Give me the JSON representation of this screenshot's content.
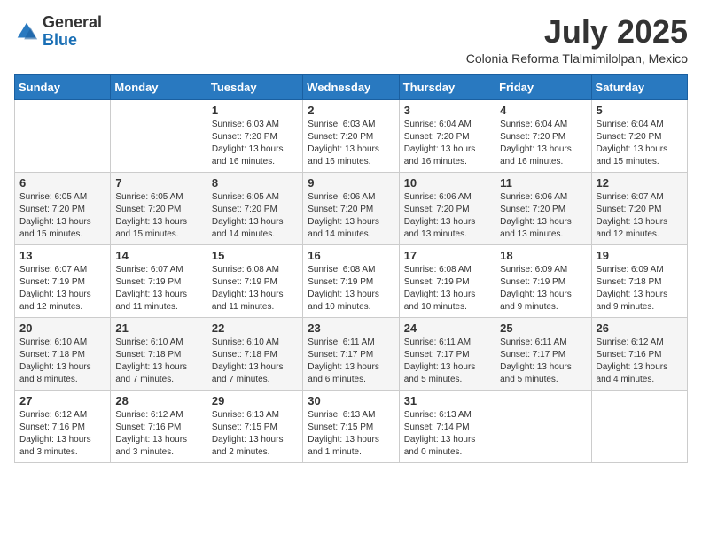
{
  "logo": {
    "general": "General",
    "blue": "Blue"
  },
  "title": {
    "month_year": "July 2025",
    "location": "Colonia Reforma Tlalmimilolpan, Mexico"
  },
  "days_of_week": [
    "Sunday",
    "Monday",
    "Tuesday",
    "Wednesday",
    "Thursday",
    "Friday",
    "Saturday"
  ],
  "weeks": [
    [
      {
        "day": "",
        "info": ""
      },
      {
        "day": "",
        "info": ""
      },
      {
        "day": "1",
        "info": "Sunrise: 6:03 AM\nSunset: 7:20 PM\nDaylight: 13 hours\nand 16 minutes."
      },
      {
        "day": "2",
        "info": "Sunrise: 6:03 AM\nSunset: 7:20 PM\nDaylight: 13 hours\nand 16 minutes."
      },
      {
        "day": "3",
        "info": "Sunrise: 6:04 AM\nSunset: 7:20 PM\nDaylight: 13 hours\nand 16 minutes."
      },
      {
        "day": "4",
        "info": "Sunrise: 6:04 AM\nSunset: 7:20 PM\nDaylight: 13 hours\nand 16 minutes."
      },
      {
        "day": "5",
        "info": "Sunrise: 6:04 AM\nSunset: 7:20 PM\nDaylight: 13 hours\nand 15 minutes."
      }
    ],
    [
      {
        "day": "6",
        "info": "Sunrise: 6:05 AM\nSunset: 7:20 PM\nDaylight: 13 hours\nand 15 minutes."
      },
      {
        "day": "7",
        "info": "Sunrise: 6:05 AM\nSunset: 7:20 PM\nDaylight: 13 hours\nand 15 minutes."
      },
      {
        "day": "8",
        "info": "Sunrise: 6:05 AM\nSunset: 7:20 PM\nDaylight: 13 hours\nand 14 minutes."
      },
      {
        "day": "9",
        "info": "Sunrise: 6:06 AM\nSunset: 7:20 PM\nDaylight: 13 hours\nand 14 minutes."
      },
      {
        "day": "10",
        "info": "Sunrise: 6:06 AM\nSunset: 7:20 PM\nDaylight: 13 hours\nand 13 minutes."
      },
      {
        "day": "11",
        "info": "Sunrise: 6:06 AM\nSunset: 7:20 PM\nDaylight: 13 hours\nand 13 minutes."
      },
      {
        "day": "12",
        "info": "Sunrise: 6:07 AM\nSunset: 7:20 PM\nDaylight: 13 hours\nand 12 minutes."
      }
    ],
    [
      {
        "day": "13",
        "info": "Sunrise: 6:07 AM\nSunset: 7:19 PM\nDaylight: 13 hours\nand 12 minutes."
      },
      {
        "day": "14",
        "info": "Sunrise: 6:07 AM\nSunset: 7:19 PM\nDaylight: 13 hours\nand 11 minutes."
      },
      {
        "day": "15",
        "info": "Sunrise: 6:08 AM\nSunset: 7:19 PM\nDaylight: 13 hours\nand 11 minutes."
      },
      {
        "day": "16",
        "info": "Sunrise: 6:08 AM\nSunset: 7:19 PM\nDaylight: 13 hours\nand 10 minutes."
      },
      {
        "day": "17",
        "info": "Sunrise: 6:08 AM\nSunset: 7:19 PM\nDaylight: 13 hours\nand 10 minutes."
      },
      {
        "day": "18",
        "info": "Sunrise: 6:09 AM\nSunset: 7:19 PM\nDaylight: 13 hours\nand 9 minutes."
      },
      {
        "day": "19",
        "info": "Sunrise: 6:09 AM\nSunset: 7:18 PM\nDaylight: 13 hours\nand 9 minutes."
      }
    ],
    [
      {
        "day": "20",
        "info": "Sunrise: 6:10 AM\nSunset: 7:18 PM\nDaylight: 13 hours\nand 8 minutes."
      },
      {
        "day": "21",
        "info": "Sunrise: 6:10 AM\nSunset: 7:18 PM\nDaylight: 13 hours\nand 7 minutes."
      },
      {
        "day": "22",
        "info": "Sunrise: 6:10 AM\nSunset: 7:18 PM\nDaylight: 13 hours\nand 7 minutes."
      },
      {
        "day": "23",
        "info": "Sunrise: 6:11 AM\nSunset: 7:17 PM\nDaylight: 13 hours\nand 6 minutes."
      },
      {
        "day": "24",
        "info": "Sunrise: 6:11 AM\nSunset: 7:17 PM\nDaylight: 13 hours\nand 5 minutes."
      },
      {
        "day": "25",
        "info": "Sunrise: 6:11 AM\nSunset: 7:17 PM\nDaylight: 13 hours\nand 5 minutes."
      },
      {
        "day": "26",
        "info": "Sunrise: 6:12 AM\nSunset: 7:16 PM\nDaylight: 13 hours\nand 4 minutes."
      }
    ],
    [
      {
        "day": "27",
        "info": "Sunrise: 6:12 AM\nSunset: 7:16 PM\nDaylight: 13 hours\nand 3 minutes."
      },
      {
        "day": "28",
        "info": "Sunrise: 6:12 AM\nSunset: 7:16 PM\nDaylight: 13 hours\nand 3 minutes."
      },
      {
        "day": "29",
        "info": "Sunrise: 6:13 AM\nSunset: 7:15 PM\nDaylight: 13 hours\nand 2 minutes."
      },
      {
        "day": "30",
        "info": "Sunrise: 6:13 AM\nSunset: 7:15 PM\nDaylight: 13 hours\nand 1 minute."
      },
      {
        "day": "31",
        "info": "Sunrise: 6:13 AM\nSunset: 7:14 PM\nDaylight: 13 hours\nand 0 minutes."
      },
      {
        "day": "",
        "info": ""
      },
      {
        "day": "",
        "info": ""
      }
    ]
  ]
}
